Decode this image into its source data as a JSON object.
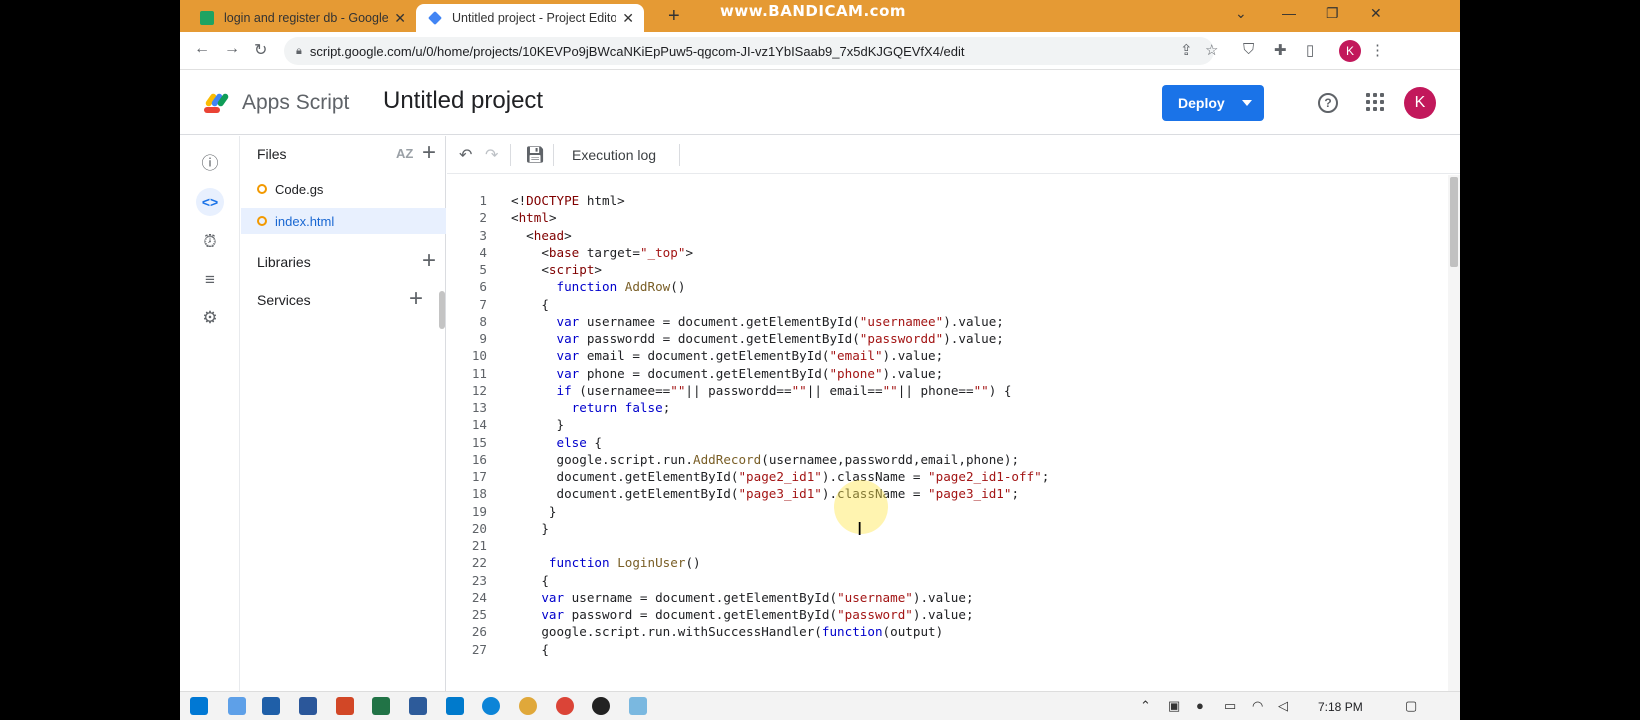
{
  "browser": {
    "tabs": [
      {
        "title": "login and register db - Google Sh",
        "favicon": "sheets-icon"
      },
      {
        "title": "Untitled project - Project Editor",
        "favicon": "apps-script-icon"
      }
    ],
    "watermark": "www.BANDICAM.com",
    "url": "script.google.com/u/0/home/projects/10KEVPo9jBWcaNKiEpPuw5-qgcom-JI-vz1YbISaab9_7x5dKJGQEVfX4/edit",
    "profile_initial": "K"
  },
  "header": {
    "app_name": "Apps Script",
    "project_name": "Untitled project",
    "deploy_label": "Deploy",
    "avatar_initial": "K"
  },
  "files_panel": {
    "files_label": "Files",
    "sort_label": "AZ",
    "files": [
      "Code.gs",
      "index.html"
    ],
    "libraries_label": "Libraries",
    "services_label": "Services"
  },
  "toolbar": {
    "execution_log_label": "Execution log"
  },
  "code_lines": [
    "<!DOCTYPE html>",
    "<html>",
    "  <head>",
    "    <base target=\"_top\">",
    "    <script>",
    "      function AddRow()",
    "    {",
    "      var usernamee = document.getElementById(\"usernamee\").value;",
    "      var passwordd = document.getElementById(\"passwordd\").value;",
    "      var email = document.getElementById(\"email\").value;",
    "      var phone = document.getElementById(\"phone\").value;",
    "      if (usernamee==\"\"|| passwordd==\"\"|| email==\"\"|| phone==\"\") {",
    "        return false;",
    "      }",
    "      else {",
    "      google.script.run.AddRecord(usernamee,passwordd,email,phone);",
    "      document.getElementById(\"page2_id1\").className = \"page2_id1-off\";",
    "      document.getElementById(\"page3_id1\").className = \"page3_id1\";",
    "     }",
    "    }",
    "",
    "     function LoginUser()",
    "    {",
    "    var username = document.getElementById(\"username\").value;",
    "    var password = document.getElementById(\"password\").value;",
    "    google.script.run.withSuccessHandler(function(output)",
    "    {"
  ],
  "taskbar": {
    "time": "7:18 PM"
  }
}
